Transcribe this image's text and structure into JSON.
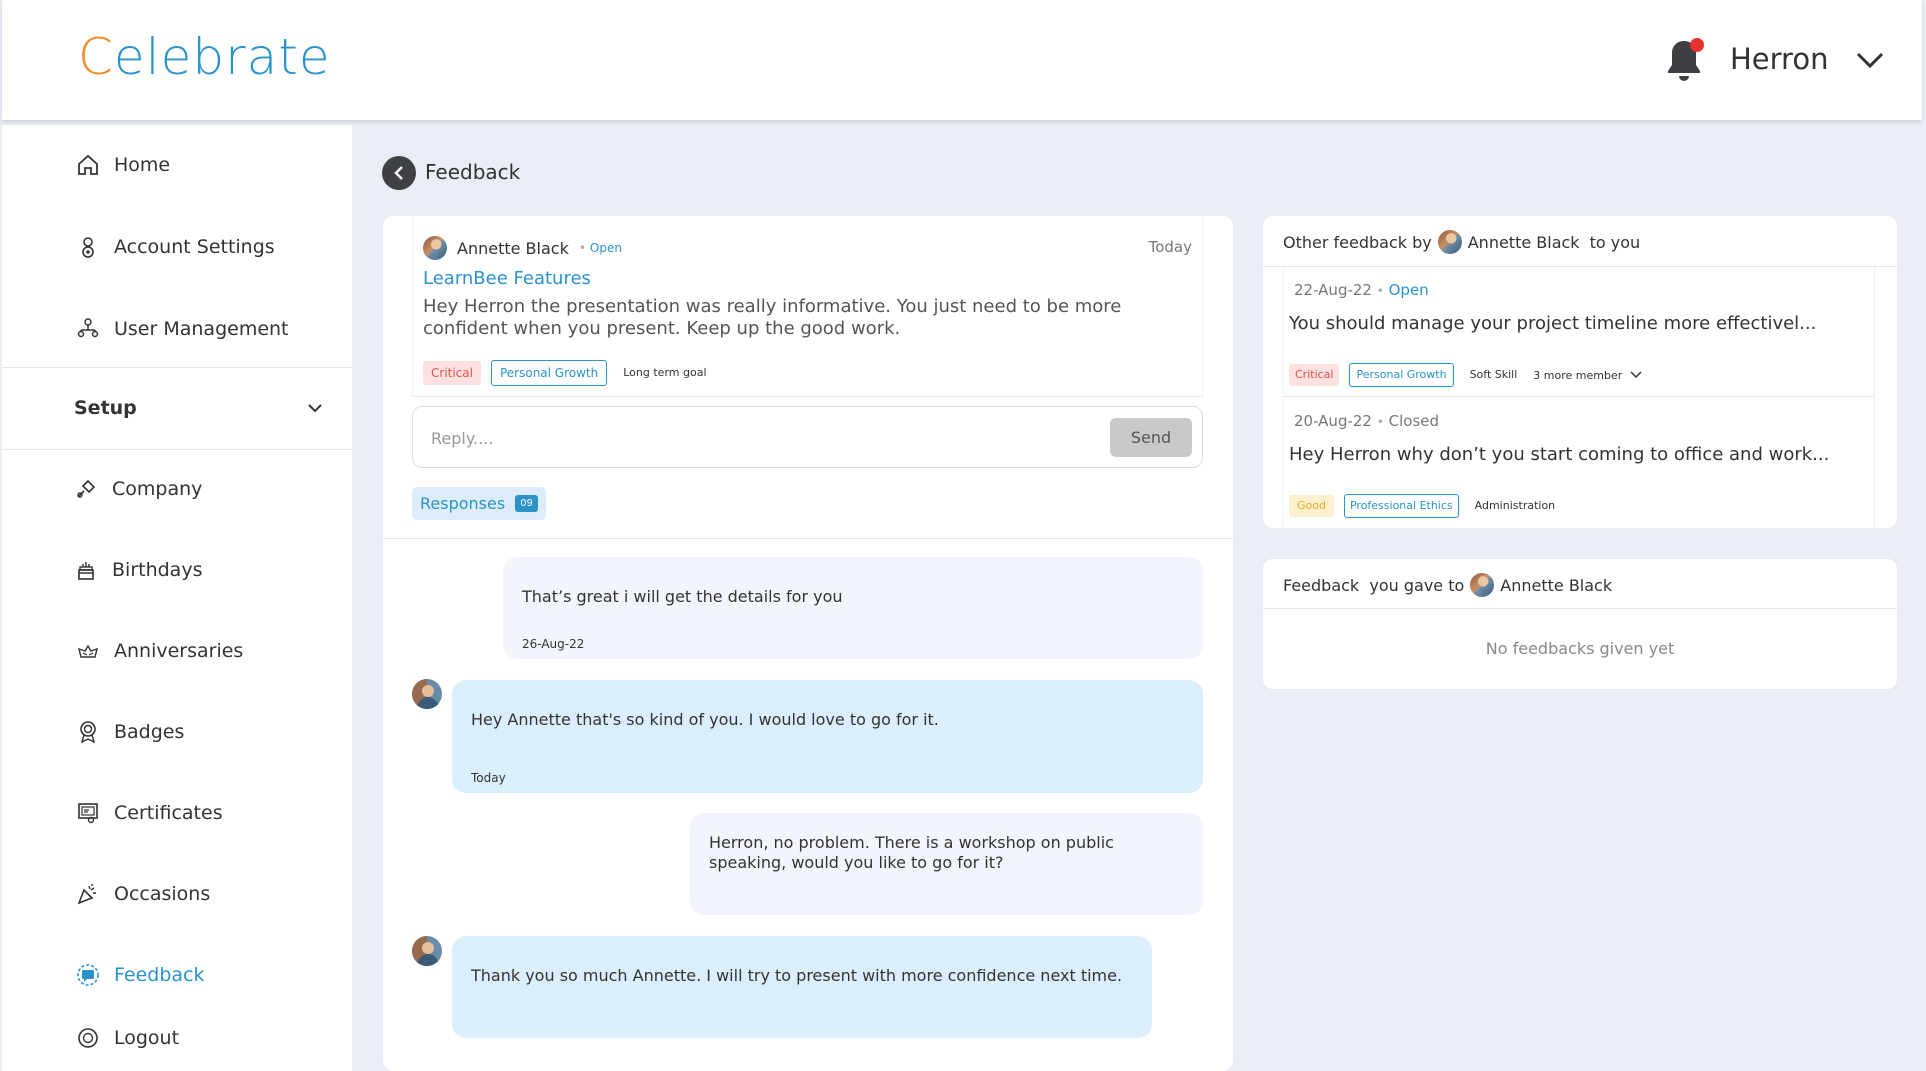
{
  "header": {
    "logo_first": "C",
    "logo_rest": "elebrate",
    "user_name": "Herron"
  },
  "sidebar": {
    "items": [
      {
        "label": "Home",
        "icon": "home-icon"
      },
      {
        "label": "Account Settings",
        "icon": "account-settings-icon"
      },
      {
        "label": "User Management",
        "icon": "user-management-icon"
      }
    ],
    "setup_label": "Setup",
    "setup_items": [
      {
        "label": "Company",
        "icon": "company-icon"
      },
      {
        "label": "Birthdays",
        "icon": "birthday-cake-icon"
      },
      {
        "label": "Anniversaries",
        "icon": "anniversary-icon"
      },
      {
        "label": "Badges",
        "icon": "badge-icon"
      },
      {
        "label": "Certificates",
        "icon": "certificate-icon"
      },
      {
        "label": "Occasions",
        "icon": "party-popper-icon"
      },
      {
        "label": "Feedback",
        "icon": "feedback-icon"
      },
      {
        "label": "Logout",
        "icon": "logout-icon"
      }
    ],
    "active_item": "Feedback"
  },
  "page": {
    "title": "Feedback"
  },
  "feedback": {
    "author": "Annette Black",
    "status": "Open",
    "date": "Today",
    "title": "LearnBee Features",
    "text": "Hey Herron the presentation was really informative. You just need to be more confident when you present. Keep up the good work.",
    "tags": [
      "Critical",
      "Personal Growth",
      "Long term goal"
    ]
  },
  "reply": {
    "placeholder": "Reply....",
    "send_label": "Send"
  },
  "responses": {
    "label": "Responses",
    "count": "09"
  },
  "messages": [
    {
      "text": "That’s great i will get the details for you",
      "date": "26-Aug-22",
      "from": "me"
    },
    {
      "text": "Hey Annette that's so kind of you. I would love to go for it.",
      "date": "Today",
      "from": "them"
    },
    {
      "text": "Herron, no problem. There is a workshop on public speaking, would you like to go for it?",
      "date": "",
      "from": "me"
    },
    {
      "text": "Thank you so much Annette. I will try to present with more confidence next time.",
      "date": "",
      "from": "them"
    }
  ],
  "other_feedback": {
    "heading_prefix": "Other feedback by",
    "author": "Annette Black",
    "heading_suffix": "to you",
    "items": [
      {
        "date": "22-Aug-22",
        "status": "Open",
        "text": "You should manage your project timeline more effectivel...",
        "tags": [
          "Critical",
          "Personal Growth",
          "Soft Skill"
        ],
        "more": "3 more member"
      },
      {
        "date": "20-Aug-22",
        "status": "Closed",
        "text": "Hey Herron why don’t you start coming to office and work...",
        "tags": [
          "Good",
          "Professional Ethics",
          "Administration"
        ]
      }
    ]
  },
  "feedback_given": {
    "heading_prefix": "Feedback  you gave to",
    "author": "Annette Black",
    "empty_text": "No feedbacks given yet"
  },
  "colors": {
    "accent": "#2a93c9",
    "logo_orange": "#f08a24",
    "notification": "#e8322f",
    "critical_bg": "#fde0e0",
    "their_message_bg": "#daeefc"
  }
}
